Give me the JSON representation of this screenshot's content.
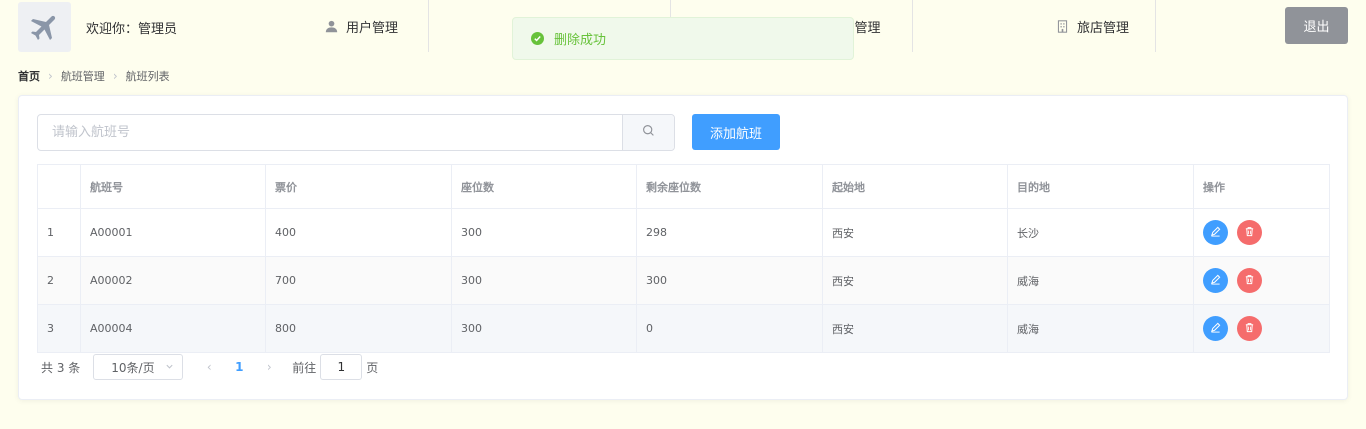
{
  "header": {
    "welcome": "欢迎你：管理员",
    "nav": [
      {
        "label": "用户管理",
        "icon": "user-icon"
      },
      {
        "label": "巴管理",
        "icon": "bus-icon"
      },
      {
        "label": "旅店管理",
        "icon": "hotel-icon"
      }
    ],
    "logout": "退出"
  },
  "toast": {
    "message": "删除成功"
  },
  "breadcrumb": [
    "首页",
    "航班管理",
    "航班列表"
  ],
  "search": {
    "placeholder": "请输入航班号",
    "value": ""
  },
  "add_button": "添加航班",
  "table": {
    "headers": [
      "",
      "航班号",
      "票价",
      "座位数",
      "剩余座位数",
      "起始地",
      "目的地",
      "操作"
    ],
    "rows": [
      {
        "index": "1",
        "flight_no": "A00001",
        "price": "400",
        "seats": "300",
        "remaining": "298",
        "origin": "西安",
        "destination": "长沙"
      },
      {
        "index": "2",
        "flight_no": "A00002",
        "price": "700",
        "seats": "300",
        "remaining": "300",
        "origin": "西安",
        "destination": "威海"
      },
      {
        "index": "3",
        "flight_no": "A00004",
        "price": "800",
        "seats": "300",
        "remaining": "0",
        "origin": "西安",
        "destination": "威海"
      }
    ]
  },
  "pagination": {
    "total": "共 3 条",
    "page_size": "10条/页",
    "current_page": "1",
    "jump_prefix": "前往",
    "jump_value": "1",
    "jump_suffix": "页"
  },
  "colors": {
    "primary": "#409eff",
    "danger": "#f56c6c",
    "success": "#67c23a",
    "logout": "#909399"
  }
}
